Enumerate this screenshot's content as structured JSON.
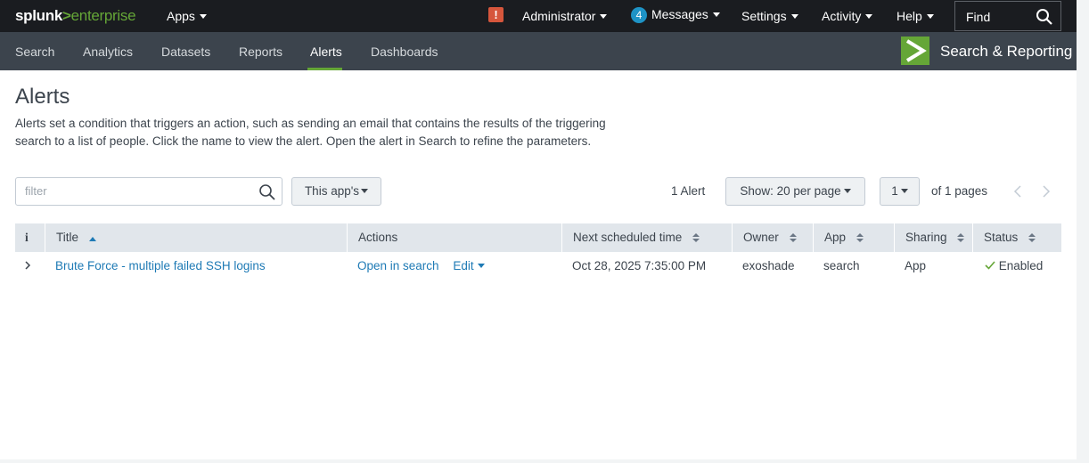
{
  "topbar": {
    "brand": "splunk",
    "brand_sep": ">",
    "product": "enterprise",
    "apps_label": "Apps",
    "alert_icon_text": "!",
    "user_label": "Administrator",
    "messages_count": "4",
    "messages_label": "Messages",
    "settings_label": "Settings",
    "activity_label": "Activity",
    "help_label": "Help",
    "find_label": "Find"
  },
  "appbar": {
    "nav": [
      "Search",
      "Analytics",
      "Datasets",
      "Reports",
      "Alerts",
      "Dashboards"
    ],
    "active_nav": "Alerts",
    "app_name": "Search & Reporting"
  },
  "page": {
    "title": "Alerts",
    "description": "Alerts set a condition that triggers an action, such as sending an email that contains the results of the triggering search to a list of people. Click the name to view the alert. Open the alert in Search to refine the parameters."
  },
  "controls": {
    "filter_placeholder": "filter",
    "scope_label": "This app's",
    "count_label": "1 Alert",
    "per_page_label": "Show: 20 per page",
    "page_select": "1",
    "pages_label": "of 1 pages"
  },
  "table": {
    "columns": {
      "info": "i",
      "title": "Title",
      "actions": "Actions",
      "next_scheduled": "Next scheduled time",
      "owner": "Owner",
      "app": "App",
      "sharing": "Sharing",
      "status": "Status"
    },
    "rows": [
      {
        "title": "Brute Force - multiple failed SSH logins",
        "action_open": "Open in search",
        "action_edit": "Edit",
        "next_scheduled": "Oct 28, 2025 7:35:00 PM",
        "owner": "exoshade",
        "app": "search",
        "sharing": "App",
        "status": "Enabled"
      }
    ]
  },
  "colors": {
    "topbar_bg": "#1a1c20",
    "appbar_bg": "#3c444d",
    "accent_green": "#65a637",
    "link_blue": "#1e7ab5",
    "alert_red": "#d6563c",
    "badge_blue": "#1e93c6"
  }
}
